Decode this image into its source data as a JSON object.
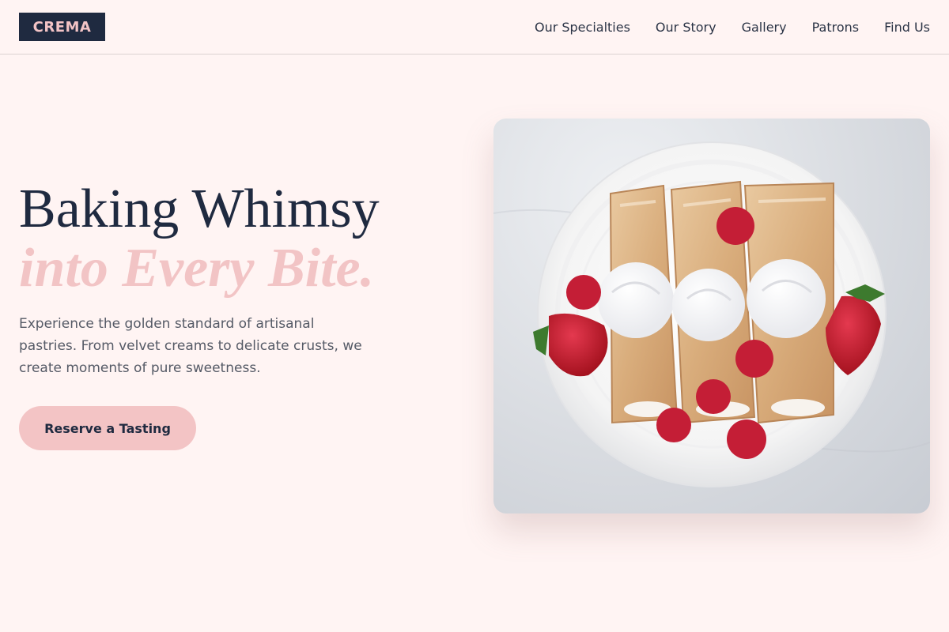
{
  "brand": {
    "logo_text": "CREMA"
  },
  "nav": {
    "items": [
      {
        "label": "Our Specialties"
      },
      {
        "label": "Our Story"
      },
      {
        "label": "Gallery"
      },
      {
        "label": "Patrons"
      },
      {
        "label": "Find Us"
      }
    ]
  },
  "hero": {
    "title_line1": "Baking Whimsy",
    "title_line2": "into Every Bite.",
    "subtitle": "Experience the golden standard of artisanal pastries. From velvet creams to delicate crusts, we create moments of pure sweetness.",
    "cta_label": "Reserve a Tasting"
  },
  "colors": {
    "background": "#fff4f3",
    "navy": "#1f2a40",
    "pink_accent": "#f3c4c5",
    "body_text": "#555a66"
  }
}
